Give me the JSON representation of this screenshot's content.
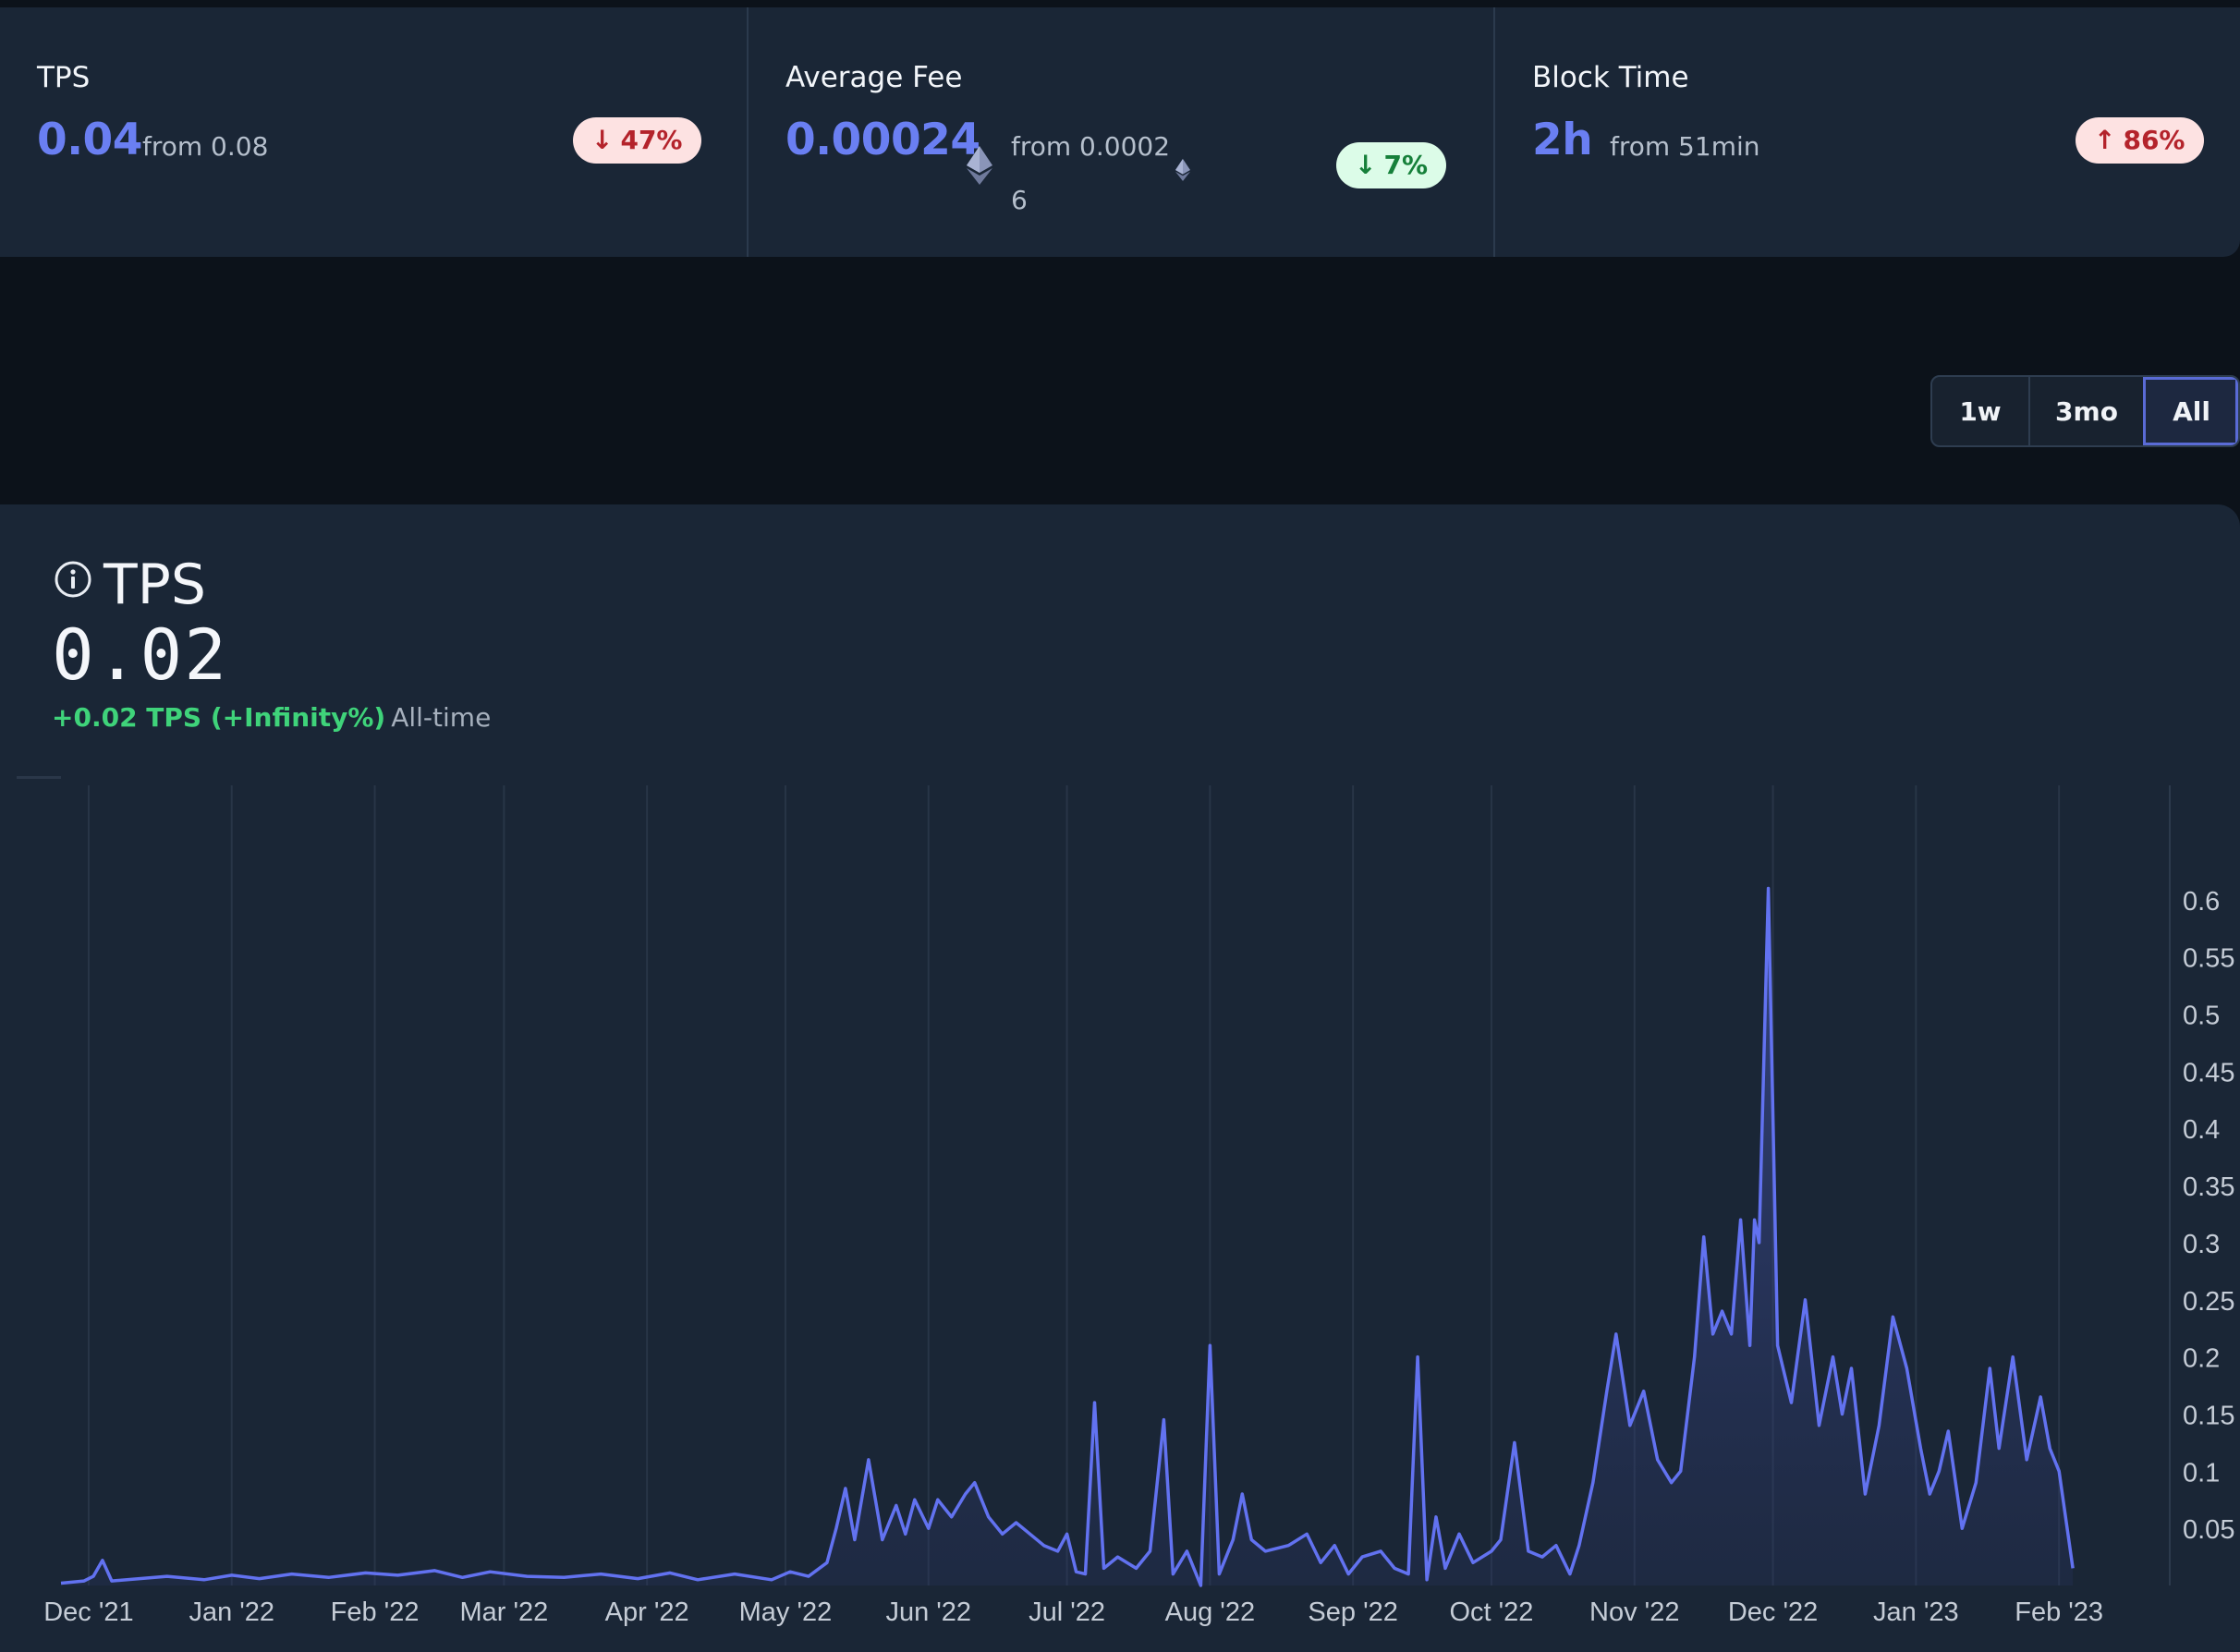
{
  "stats": [
    {
      "label": "TPS",
      "value": "0.04",
      "from": "from 0.08",
      "from_cont": "",
      "badge": "47%",
      "badge_dir": "down",
      "badge_tone": "neg"
    },
    {
      "label": "Average Fee",
      "value": "0.00024",
      "from": "from 0.0002",
      "from_cont": "6",
      "badge": "7%",
      "badge_dir": "down",
      "badge_tone": "pos"
    },
    {
      "label": "Block Time",
      "value": "2h",
      "from": "from 51min",
      "from_cont": "",
      "badge": "86%",
      "badge_dir": "up",
      "badge_tone": "neg"
    }
  ],
  "icons": {
    "badge_down": "arrow-down-icon",
    "badge_up": "arrow-up-icon",
    "fee_unit": "ethereum-icon",
    "card_info": "info-icon"
  },
  "range": {
    "options": [
      "1w",
      "3mo",
      "All"
    ],
    "selected": "All"
  },
  "card": {
    "title": "TPS",
    "value": "0.02",
    "delta": "+0.02 TPS (+Infinity%)",
    "period": "All-time"
  },
  "colors": {
    "accent": "#6a7ff2",
    "line": "#6272f0",
    "negative_badge_bg": "#fde2e2",
    "negative_badge_text": "#b4232b",
    "positive_badge_bg": "#dcfce8",
    "positive_badge_text": "#16803a",
    "delta_positive": "#3fd37a"
  },
  "chart_data": {
    "type": "area",
    "title": "TPS",
    "xlabel": "",
    "ylabel": "",
    "grid": "vertical",
    "yaxis_side": "right",
    "x_domain": [
      "2021-11-25",
      "2023-02-25"
    ],
    "ylim": [
      0,
      0.65
    ],
    "y_ticks": [
      0.05,
      0.1,
      0.15,
      0.2,
      0.25,
      0.3,
      0.35,
      0.4,
      0.45,
      0.5,
      0.55,
      0.6
    ],
    "y_tick_labels": [
      "0.05",
      "0.1",
      "0.15",
      "0.2",
      "0.25",
      "0.3",
      "0.35",
      "0.4",
      "0.45",
      "0.5",
      "0.55",
      "0.6"
    ],
    "x_ticks": [
      "2021-12-01",
      "2022-01-01",
      "2022-02-01",
      "2022-03-01",
      "2022-04-01",
      "2022-05-01",
      "2022-06-01",
      "2022-07-01",
      "2022-08-01",
      "2022-09-01",
      "2022-10-01",
      "2022-11-01",
      "2022-12-01",
      "2023-01-01",
      "2023-02-01"
    ],
    "x_tick_labels": [
      "Dec '21",
      "Jan '22",
      "Feb '22",
      "Mar '22",
      "Apr '22",
      "May '22",
      "Jun '22",
      "Jul '22",
      "Aug '22",
      "Sep '22",
      "Oct '22",
      "Nov '22",
      "Dec '22",
      "Jan '23",
      "Feb '23"
    ],
    "series": [
      {
        "name": "TPS",
        "points": [
          [
            "2021-11-25",
            0.002
          ],
          [
            "2021-11-30",
            0.004
          ],
          [
            "2021-12-02",
            0.008
          ],
          [
            "2021-12-04",
            0.022
          ],
          [
            "2021-12-06",
            0.004
          ],
          [
            "2021-12-12",
            0.006
          ],
          [
            "2021-12-18",
            0.008
          ],
          [
            "2021-12-26",
            0.005
          ],
          [
            "2022-01-01",
            0.009
          ],
          [
            "2022-01-07",
            0.006
          ],
          [
            "2022-01-14",
            0.01
          ],
          [
            "2022-01-22",
            0.007
          ],
          [
            "2022-01-30",
            0.011
          ],
          [
            "2022-02-06",
            0.009
          ],
          [
            "2022-02-14",
            0.013
          ],
          [
            "2022-02-20",
            0.007
          ],
          [
            "2022-02-26",
            0.012
          ],
          [
            "2022-03-06",
            0.008
          ],
          [
            "2022-03-14",
            0.007
          ],
          [
            "2022-03-22",
            0.01
          ],
          [
            "2022-03-30",
            0.006
          ],
          [
            "2022-04-06",
            0.011
          ],
          [
            "2022-04-12",
            0.005
          ],
          [
            "2022-04-20",
            0.01
          ],
          [
            "2022-04-28",
            0.005
          ],
          [
            "2022-05-02",
            0.012
          ],
          [
            "2022-05-06",
            0.008
          ],
          [
            "2022-05-10",
            0.02
          ],
          [
            "2022-05-12",
            0.05
          ],
          [
            "2022-05-14",
            0.085
          ],
          [
            "2022-05-16",
            0.04
          ],
          [
            "2022-05-19",
            0.11
          ],
          [
            "2022-05-22",
            0.04
          ],
          [
            "2022-05-25",
            0.07
          ],
          [
            "2022-05-27",
            0.045
          ],
          [
            "2022-05-29",
            0.075
          ],
          [
            "2022-06-01",
            0.05
          ],
          [
            "2022-06-03",
            0.075
          ],
          [
            "2022-06-06",
            0.06
          ],
          [
            "2022-06-09",
            0.08
          ],
          [
            "2022-06-11",
            0.09
          ],
          [
            "2022-06-14",
            0.06
          ],
          [
            "2022-06-17",
            0.045
          ],
          [
            "2022-06-20",
            0.055
          ],
          [
            "2022-06-23",
            0.045
          ],
          [
            "2022-06-26",
            0.035
          ],
          [
            "2022-06-29",
            0.03
          ],
          [
            "2022-07-01",
            0.045
          ],
          [
            "2022-07-03",
            0.012
          ],
          [
            "2022-07-05",
            0.01
          ],
          [
            "2022-07-07",
            0.16
          ],
          [
            "2022-07-09",
            0.015
          ],
          [
            "2022-07-12",
            0.025
          ],
          [
            "2022-07-16",
            0.015
          ],
          [
            "2022-07-19",
            0.03
          ],
          [
            "2022-07-22",
            0.145
          ],
          [
            "2022-07-24",
            0.01
          ],
          [
            "2022-07-27",
            0.03
          ],
          [
            "2022-07-30",
            0.0
          ],
          [
            "2022-08-01",
            0.21
          ],
          [
            "2022-08-03",
            0.01
          ],
          [
            "2022-08-06",
            0.04
          ],
          [
            "2022-08-08",
            0.08
          ],
          [
            "2022-08-10",
            0.04
          ],
          [
            "2022-08-13",
            0.03
          ],
          [
            "2022-08-18",
            0.035
          ],
          [
            "2022-08-22",
            0.045
          ],
          [
            "2022-08-25",
            0.02
          ],
          [
            "2022-08-28",
            0.035
          ],
          [
            "2022-08-31",
            0.01
          ],
          [
            "2022-09-03",
            0.025
          ],
          [
            "2022-09-07",
            0.03
          ],
          [
            "2022-09-10",
            0.015
          ],
          [
            "2022-09-13",
            0.01
          ],
          [
            "2022-09-15",
            0.2
          ],
          [
            "2022-09-17",
            0.005
          ],
          [
            "2022-09-19",
            0.06
          ],
          [
            "2022-09-21",
            0.015
          ],
          [
            "2022-09-24",
            0.045
          ],
          [
            "2022-09-27",
            0.02
          ],
          [
            "2022-10-01",
            0.03
          ],
          [
            "2022-10-03",
            0.04
          ],
          [
            "2022-10-06",
            0.125
          ],
          [
            "2022-10-09",
            0.03
          ],
          [
            "2022-10-12",
            0.025
          ],
          [
            "2022-10-15",
            0.035
          ],
          [
            "2022-10-18",
            0.01
          ],
          [
            "2022-10-20",
            0.035
          ],
          [
            "2022-10-23",
            0.09
          ],
          [
            "2022-10-26",
            0.17
          ],
          [
            "2022-10-28",
            0.22
          ],
          [
            "2022-10-31",
            0.14
          ],
          [
            "2022-11-03",
            0.17
          ],
          [
            "2022-11-06",
            0.11
          ],
          [
            "2022-11-09",
            0.09
          ],
          [
            "2022-11-11",
            0.1
          ],
          [
            "2022-11-14",
            0.2
          ],
          [
            "2022-11-16",
            0.305
          ],
          [
            "2022-11-18",
            0.22
          ],
          [
            "2022-11-20",
            0.24
          ],
          [
            "2022-11-22",
            0.22
          ],
          [
            "2022-11-24",
            0.32
          ],
          [
            "2022-11-26",
            0.21
          ],
          [
            "2022-11-27",
            0.32
          ],
          [
            "2022-11-28",
            0.3
          ],
          [
            "2022-11-30",
            0.61
          ],
          [
            "2022-12-02",
            0.21
          ],
          [
            "2022-12-05",
            0.16
          ],
          [
            "2022-12-08",
            0.25
          ],
          [
            "2022-12-11",
            0.14
          ],
          [
            "2022-12-14",
            0.2
          ],
          [
            "2022-12-16",
            0.15
          ],
          [
            "2022-12-18",
            0.19
          ],
          [
            "2022-12-21",
            0.08
          ],
          [
            "2022-12-24",
            0.14
          ],
          [
            "2022-12-27",
            0.235
          ],
          [
            "2022-12-30",
            0.19
          ],
          [
            "2023-01-02",
            0.12
          ],
          [
            "2023-01-04",
            0.08
          ],
          [
            "2023-01-06",
            0.1
          ],
          [
            "2023-01-08",
            0.135
          ],
          [
            "2023-01-11",
            0.05
          ],
          [
            "2023-01-14",
            0.09
          ],
          [
            "2023-01-17",
            0.19
          ],
          [
            "2023-01-19",
            0.12
          ],
          [
            "2023-01-22",
            0.2
          ],
          [
            "2023-01-25",
            0.11
          ],
          [
            "2023-01-28",
            0.165
          ],
          [
            "2023-01-30",
            0.12
          ],
          [
            "2023-02-01",
            0.1
          ],
          [
            "2023-02-04",
            0.015
          ]
        ]
      }
    ]
  }
}
